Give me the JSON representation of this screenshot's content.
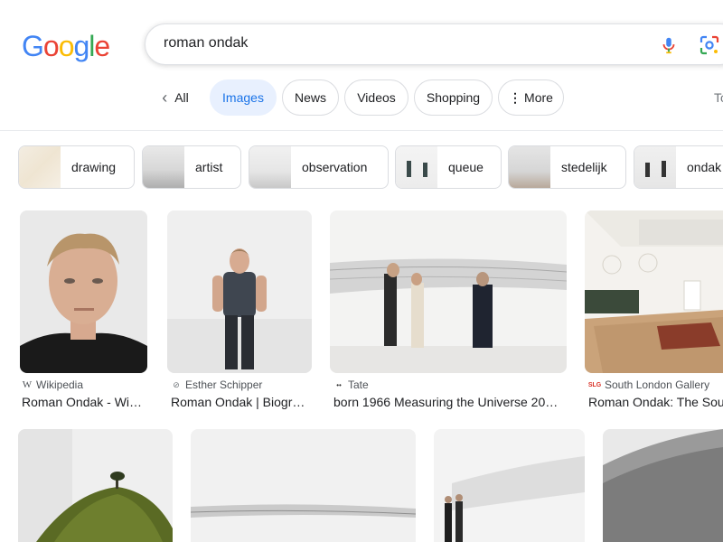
{
  "logo": "Google",
  "search": {
    "query": "roman ondak"
  },
  "tabs": {
    "back": "All",
    "images": "Images",
    "news": "News",
    "videos": "Videos",
    "shopping": "Shopping",
    "more": "More",
    "tools": "To"
  },
  "chips": [
    "drawing",
    "artist",
    "observation",
    "queue",
    "stedelijk",
    "ondak"
  ],
  "results": [
    {
      "source": "Wikipedia",
      "title": "Roman Ondak - Wik…"
    },
    {
      "source": "Esther Schipper",
      "title": "Roman Ondak | Biogra…"
    },
    {
      "source": "Tate",
      "title": "born 1966 Measuring the Universe 20…"
    },
    {
      "source": "South London Gallery",
      "source_badge": "SLG",
      "title": "Roman Ondak: The Sou"
    }
  ],
  "colors": {
    "blue": "#4285F4",
    "red": "#EA4335",
    "yellow": "#FBBC05",
    "green": "#34A853",
    "active_tab_bg": "#e8f0fe",
    "active_tab_text": "#1a73e8"
  }
}
